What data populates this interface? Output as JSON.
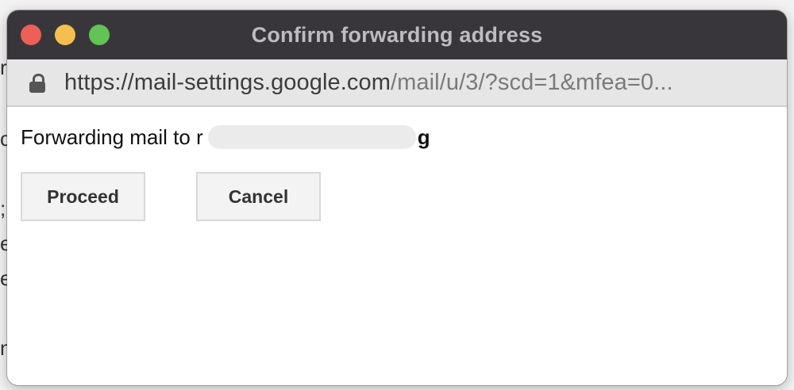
{
  "window": {
    "title": "Confirm forwarding address",
    "controls": {
      "close_color": "#ed5f57",
      "minimize_color": "#f5bf4f",
      "maximize_color": "#61c454"
    }
  },
  "urlbar": {
    "icon": "lock-icon",
    "url_host": "https://mail-settings.google.com",
    "url_path": "/mail/u/3/?scd=1&mfea=0..."
  },
  "content": {
    "message_prefix": "Forwarding mail to r",
    "message_suffix": "g",
    "proceed_label": "Proceed",
    "cancel_label": "Cancel"
  },
  "background": {
    "letters": [
      "r",
      "c",
      ";",
      "e",
      "e",
      "n"
    ]
  }
}
